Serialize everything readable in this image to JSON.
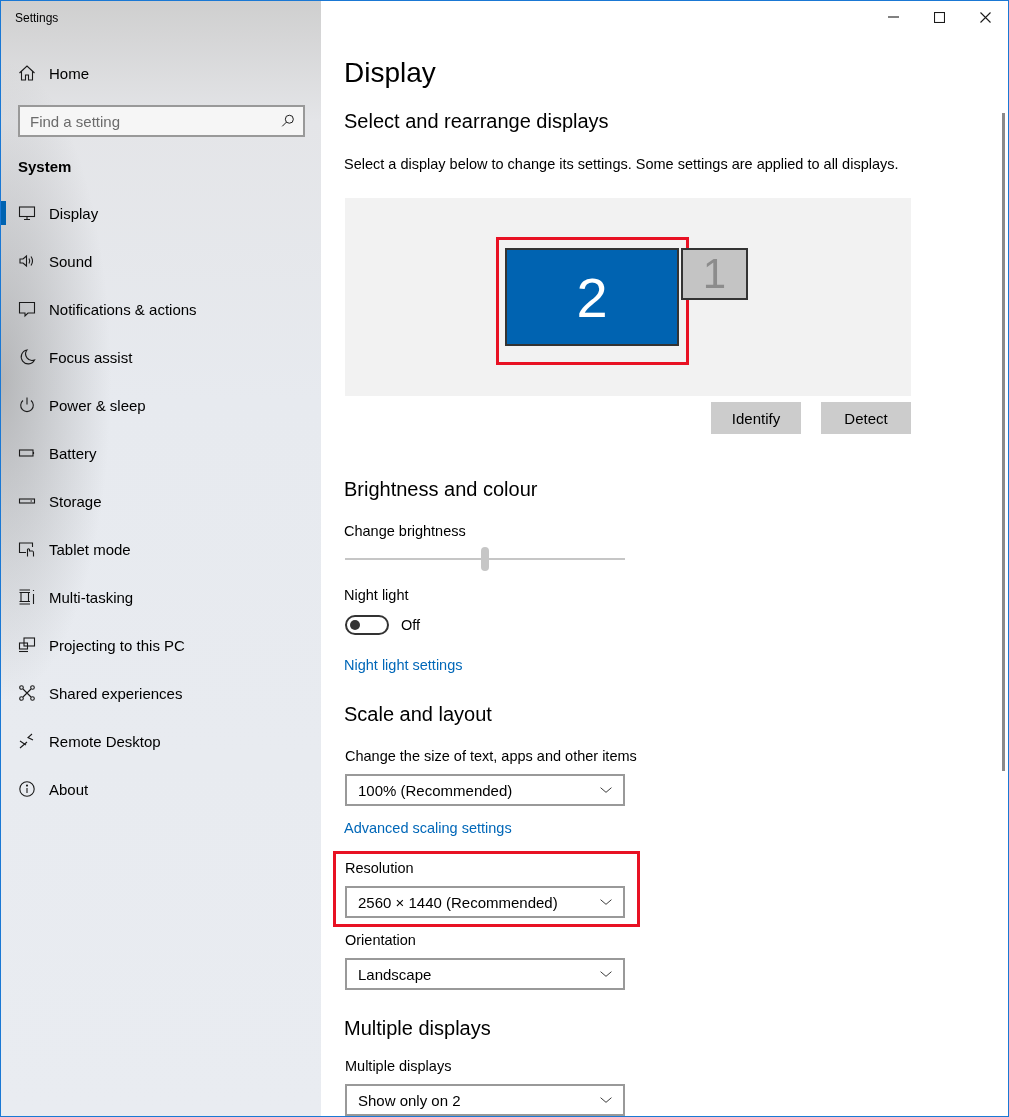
{
  "window": {
    "title": "Settings"
  },
  "sidebar": {
    "home": "Home",
    "search": {
      "placeholder": "Find a setting"
    },
    "section": "System",
    "items": [
      {
        "label": "Display",
        "selected": true
      },
      {
        "label": "Sound",
        "selected": false
      },
      {
        "label": "Notifications & actions",
        "selected": false
      },
      {
        "label": "Focus assist",
        "selected": false
      },
      {
        "label": "Power & sleep",
        "selected": false
      },
      {
        "label": "Battery",
        "selected": false
      },
      {
        "label": "Storage",
        "selected": false
      },
      {
        "label": "Tablet mode",
        "selected": false
      },
      {
        "label": "Multi-tasking",
        "selected": false
      },
      {
        "label": "Projecting to this PC",
        "selected": false
      },
      {
        "label": "Shared experiences",
        "selected": false
      },
      {
        "label": "Remote Desktop",
        "selected": false
      },
      {
        "label": "About",
        "selected": false
      }
    ]
  },
  "main": {
    "title": "Display",
    "arrange": {
      "heading": "Select and rearrange displays",
      "description": "Select a display below to change its settings. Some settings are applied to all displays.",
      "displays": [
        {
          "number": "2",
          "selected": true,
          "highlighted": true
        },
        {
          "number": "1",
          "selected": false,
          "highlighted": false
        }
      ],
      "buttons": [
        "Identify",
        "Detect"
      ]
    },
    "brightness": {
      "heading": "Brightness and colour",
      "label": "Change brightness",
      "level": 0.5,
      "night_light": {
        "label": "Night light",
        "on": false,
        "state_text": "Off"
      },
      "link": "Night light settings"
    },
    "scale": {
      "heading": "Scale and layout",
      "items": [
        {
          "kind": "select",
          "label": "Change the size of text, apps and other items",
          "value": "100% (Recommended)",
          "highlighted": false
        },
        {
          "kind": "link",
          "label": "Advanced scaling settings"
        },
        {
          "kind": "select",
          "label": "Resolution",
          "value": "2560 × 1440 (Recommended)",
          "highlighted": true
        },
        {
          "kind": "select",
          "label": "Orientation",
          "value": "Landscape",
          "highlighted": false
        }
      ]
    },
    "multiple": {
      "heading": "Multiple displays",
      "label": "Multiple displays",
      "value": "Show only on 2"
    }
  }
}
